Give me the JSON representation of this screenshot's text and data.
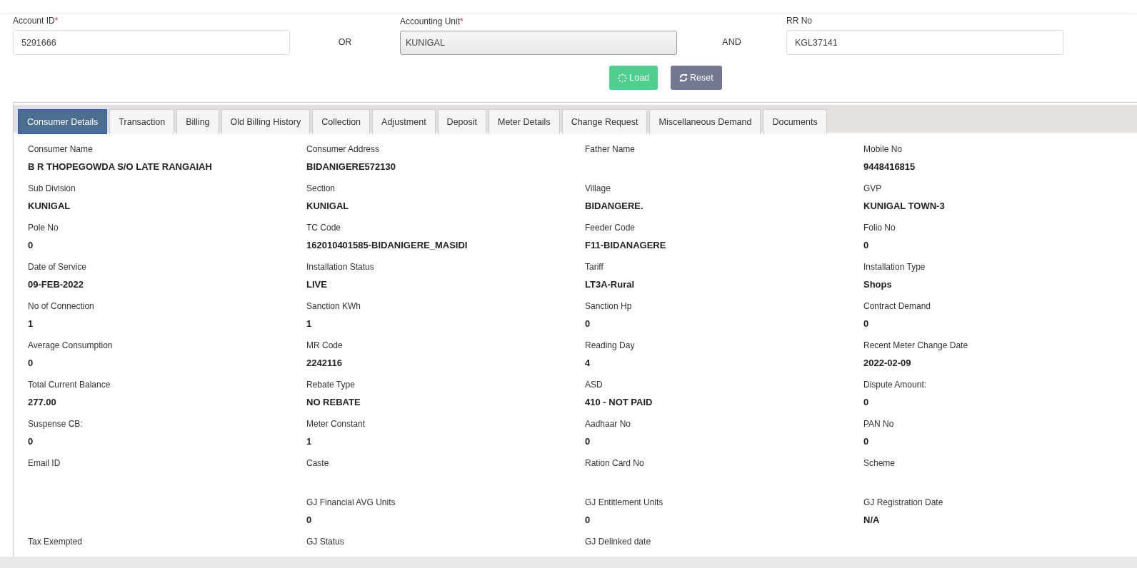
{
  "search": {
    "fields": [
      {
        "label": "Account ID",
        "required_mark": "*",
        "kind": "input",
        "value": "5291666"
      },
      {
        "label": "Accounting Unit",
        "required_mark": "*",
        "kind": "select",
        "value": "KUNIGAL"
      },
      {
        "label": "RR No",
        "kind": "input",
        "value": "KGL37141"
      }
    ],
    "connectors": [
      "OR",
      "AND"
    ],
    "buttons": [
      {
        "label": "Load",
        "kind": "primary"
      },
      {
        "label": "Reset",
        "kind": "secondary"
      }
    ]
  },
  "tabs": [
    {
      "label": "Consumer Details",
      "selected": true
    },
    {
      "label": "Transaction",
      "selected": false
    },
    {
      "label": "Billing",
      "selected": false
    },
    {
      "label": "Old Billing History",
      "selected": false
    },
    {
      "label": "Collection",
      "selected": false
    },
    {
      "label": "Adjustment",
      "selected": false
    },
    {
      "label": "Deposit",
      "selected": false
    },
    {
      "label": "Meter Details",
      "selected": false
    },
    {
      "label": "Change Request",
      "selected": false
    },
    {
      "label": "Miscellaneous Demand",
      "selected": false
    },
    {
      "label": "Documents",
      "selected": false
    }
  ],
  "details": {
    "rows": [
      [
        {
          "label": "Consumer Name",
          "value": "B R THOPEGOWDA S/O LATE RANGAIAH"
        },
        {
          "label": "Consumer Address",
          "value": "BIDANIGERE572130"
        },
        {
          "label": "Father Name"
        },
        {
          "label": "Mobile No",
          "value": "9448416815"
        }
      ],
      [
        {
          "label": "Sub Division",
          "value": "KUNIGAL"
        },
        {
          "label": "Section",
          "value": "KUNIGAL"
        },
        {
          "label": "Village",
          "value": "BIDANGERE."
        },
        {
          "label": "GVP",
          "value": "KUNIGAL TOWN-3"
        }
      ],
      [
        {
          "label": "Pole No",
          "value": "0"
        },
        {
          "label": "TC Code",
          "value": "162010401585-BIDANIGERE_MASIDI"
        },
        {
          "label": "Feeder Code",
          "value": "F11-BIDANAGERE"
        },
        {
          "label": "Folio No",
          "value": "0"
        }
      ],
      [
        {
          "label": "Date of Service",
          "value": "09-FEB-2022"
        },
        {
          "label": "Installation Status",
          "value": "LIVE"
        },
        {
          "label": "Tariff",
          "value": "LT3A-Rural"
        },
        {
          "label": "Installation Type",
          "value": "Shops"
        }
      ],
      [
        {
          "label": "No of Connection",
          "value": "1"
        },
        {
          "label": "Sanction KWh",
          "value": "1"
        },
        {
          "label": "Sanction Hp",
          "value": "0"
        },
        {
          "label": "Contract Demand",
          "value": "0"
        }
      ],
      [
        {
          "label": "Average Consumption",
          "value": "0"
        },
        {
          "label": "MR Code",
          "value": "2242116"
        },
        {
          "label": "Reading Day",
          "value": "4"
        },
        {
          "label": "Recent Meter Change Date",
          "value": "2022-02-09"
        }
      ],
      [
        {
          "label": "Total Current Balance",
          "value": "277.00"
        },
        {
          "label": "Rebate Type",
          "value": "NO REBATE"
        },
        {
          "label": "ASD",
          "value": "410 - NOT PAID"
        },
        {
          "label": "Dispute Amount:",
          "value": "0"
        }
      ],
      [
        {
          "label": "Suspense CB:",
          "value": "0"
        },
        {
          "label": "Meter Constant",
          "value": "1"
        },
        {
          "label": "Aadhaar No",
          "value": "0"
        },
        {
          "label": "PAN No",
          "value": "0"
        }
      ],
      [
        {
          "label": "Email ID"
        },
        {
          "label": "Caste"
        },
        {
          "label": "Ration Card No"
        },
        {
          "label": "Scheme"
        }
      ],
      [
        null,
        {
          "label": "GJ Financial AVG Units",
          "value": "0"
        },
        {
          "label": "GJ Entitlement Units",
          "value": "0"
        },
        {
          "label": "GJ Registration Date",
          "value": "N/A"
        }
      ],
      [
        {
          "label": "Tax Exempted"
        },
        {
          "label": "GJ Status"
        },
        {
          "label": "GJ Delinked date"
        },
        null
      ]
    ]
  }
}
